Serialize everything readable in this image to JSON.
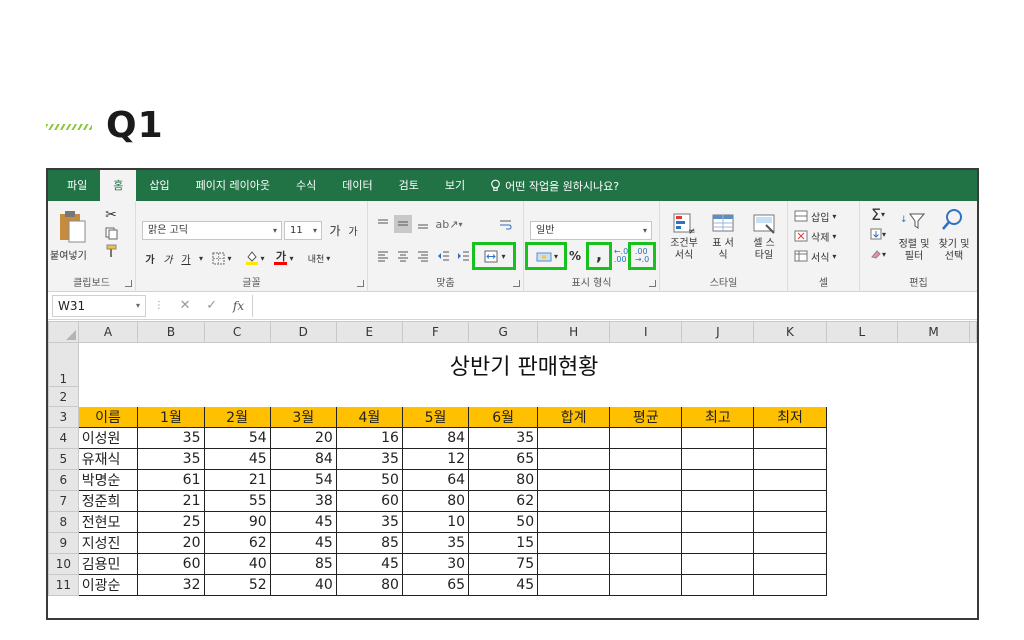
{
  "heading": "Q1",
  "menu": {
    "tabs": [
      "파일",
      "홈",
      "삽입",
      "페이지 레이아웃",
      "수식",
      "데이터",
      "검토",
      "보기"
    ],
    "active_index": 1,
    "tell_me": "어떤 작업을 원하시나요?"
  },
  "ribbon": {
    "clipboard": {
      "paste": "붙여넣기",
      "label": "클립보드"
    },
    "font": {
      "name": "맑은 고딕",
      "size": "11",
      "bold": "가",
      "italic": "가",
      "underline": "가",
      "font_color": "가",
      "phonetic": "내천",
      "label": "글꼴"
    },
    "alignment": {
      "label": "맞춤"
    },
    "number": {
      "format": "일반",
      "percent": "%",
      "comma": ",",
      "label": "표시 형식"
    },
    "styles": {
      "conditional": "조건부 서식",
      "table": "표 서식",
      "cell": "셀 스타일",
      "label": "스타일"
    },
    "cells": {
      "insert": "삽입",
      "delete": "삭제",
      "format": "서식",
      "label": "셀"
    },
    "editing": {
      "sort": "정렬 및 필터",
      "find": "찾기 및 선택",
      "label": "편집"
    },
    "highlight_color": "#19c11e"
  },
  "formula_bar": {
    "name_box": "W31",
    "fx": "fx",
    "formula": ""
  },
  "sheet": {
    "columns": [
      "A",
      "B",
      "C",
      "D",
      "E",
      "F",
      "G",
      "H",
      "I",
      "J",
      "K",
      "L",
      "M"
    ],
    "title": "상반기 판매현황",
    "headers": [
      "이름",
      "1월",
      "2월",
      "3월",
      "4월",
      "5월",
      "6월",
      "합계",
      "평균",
      "최고",
      "최저"
    ],
    "rows": [
      {
        "name": "이성원",
        "values": [
          35,
          54,
          20,
          16,
          84,
          35
        ]
      },
      {
        "name": "유재식",
        "values": [
          35,
          45,
          84,
          35,
          12,
          65
        ]
      },
      {
        "name": "박명순",
        "values": [
          61,
          21,
          54,
          50,
          64,
          80
        ]
      },
      {
        "name": "정준희",
        "values": [
          21,
          55,
          38,
          60,
          80,
          62
        ]
      },
      {
        "name": "전현모",
        "values": [
          25,
          90,
          45,
          35,
          10,
          50
        ]
      },
      {
        "name": "지성진",
        "values": [
          20,
          62,
          45,
          85,
          35,
          15
        ]
      },
      {
        "name": "김용민",
        "values": [
          60,
          40,
          85,
          45,
          30,
          75
        ]
      },
      {
        "name": "이광순",
        "values": [
          32,
          52,
          40,
          80,
          65,
          45
        ]
      }
    ],
    "header_fill": "#ffc000"
  }
}
